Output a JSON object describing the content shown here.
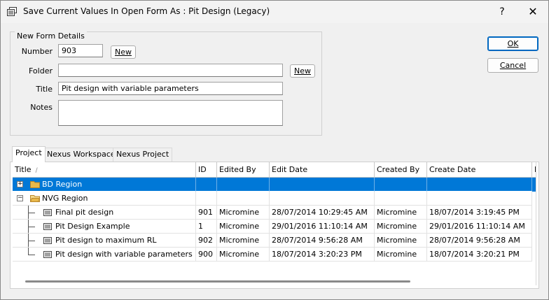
{
  "window": {
    "title": "Save Current Values In Open Form As : Pit Design (Legacy)",
    "help_label": "?",
    "close_label": "✕"
  },
  "form_details": {
    "legend": "New Form Details",
    "number_label": "Number",
    "number_value": "903",
    "number_new_label": "New",
    "folder_label": "Folder",
    "folder_value": "",
    "folder_new_label": "New",
    "title_label": "Title",
    "title_value": "Pit design with variable parameters",
    "notes_label": "Notes",
    "notes_value": ""
  },
  "buttons": {
    "ok_label": "OK",
    "cancel_label": "Cancel"
  },
  "tabs": [
    {
      "label": "Project",
      "active": true
    },
    {
      "label": "Nexus Workspace",
      "active": false
    },
    {
      "label": "Nexus Project",
      "active": false
    }
  ],
  "grid": {
    "columns": [
      "Title",
      "ID",
      "Edited By",
      "Edit Date",
      "Created By",
      "Create Date",
      "M"
    ],
    "rows": [
      {
        "type": "folder",
        "title": "BD Region",
        "expander": "+",
        "selected": true
      },
      {
        "type": "folder",
        "title": "NVG Region",
        "expander": "−",
        "selected": false
      },
      {
        "type": "form",
        "title": "Final pit design",
        "id": "901",
        "edited_by": "Micromine",
        "edit_date": "28/07/2014 10:29:45 AM",
        "created_by": "Micromine",
        "create_date": "18/07/2014 3:19:45 PM"
      },
      {
        "type": "form",
        "title": "Pit Design Example",
        "id": "1",
        "edited_by": "Micromine",
        "edit_date": "29/01/2016 11:10:14 AM",
        "created_by": "Micromine",
        "create_date": "29/01/2016 11:10:14 AM"
      },
      {
        "type": "form",
        "title": "Pit design to maximum RL",
        "id": "902",
        "edited_by": "Micromine",
        "edit_date": "28/07/2014 9:56:28 AM",
        "created_by": "Micromine",
        "create_date": "28/07/2014 9:56:28 AM"
      },
      {
        "type": "form",
        "title": "Pit design with variable parameters",
        "id": "900",
        "edited_by": "Micromine",
        "edit_date": "18/07/2014 3:20:23 PM",
        "created_by": "Micromine",
        "create_date": "18/07/2014 3:20:21 PM"
      }
    ]
  },
  "colors": {
    "selection": "#0078d7",
    "folder": "#e8b84a",
    "default_button_border": "#0067c0"
  },
  "icons": {
    "app": "window-stack-icon",
    "folder": "folder-icon",
    "form": "form-icon",
    "sort": "sort-indicator-icon"
  }
}
